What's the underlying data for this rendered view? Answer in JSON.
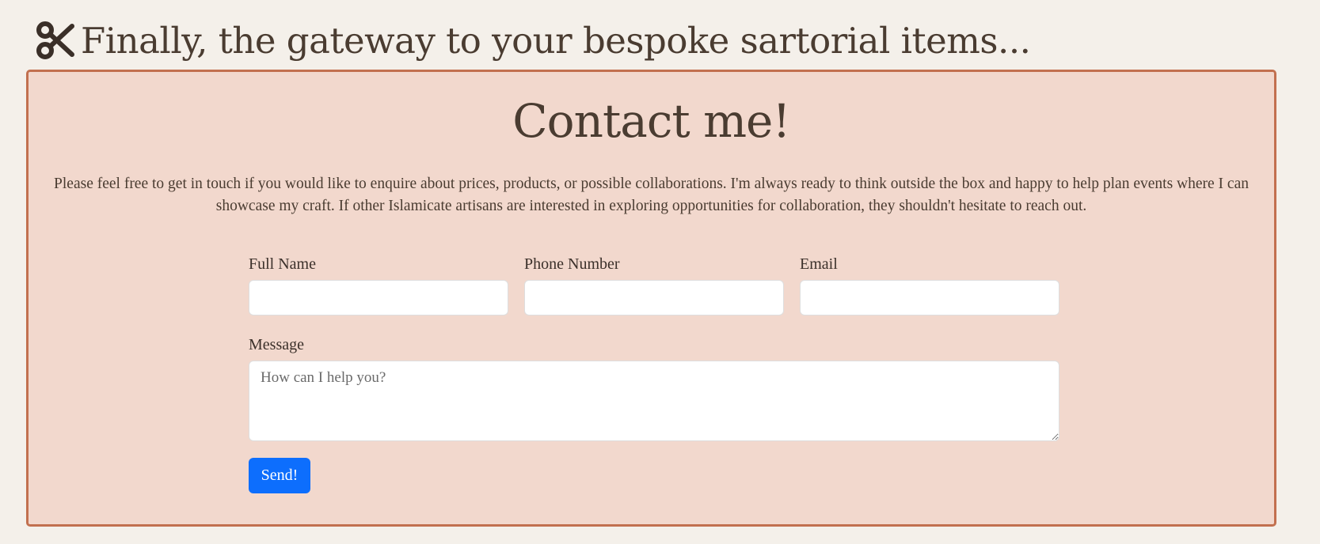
{
  "header": {
    "icon": "scissors-icon",
    "title": "Finally, the gateway to your bespoke sartorial items..."
  },
  "contact": {
    "heading": "Contact me!",
    "intro": "Please feel free to get in touch if you would like to enquire about prices, products, or possible collaborations. I'm always ready to think outside the box and happy to help plan events where I can showcase my craft. If other Islamicate artisans are interested in exploring opportunities for collaboration, they shouldn't hesitate to reach out.",
    "form": {
      "full_name": {
        "label": "Full Name",
        "value": ""
      },
      "phone": {
        "label": "Phone Number",
        "value": ""
      },
      "email": {
        "label": "Email",
        "value": ""
      },
      "message": {
        "label": "Message",
        "placeholder": "How can I help you?",
        "value": ""
      },
      "submit_label": "Send!"
    }
  },
  "colors": {
    "page_background": "#f4f0ea",
    "card_background": "#f2d8cd",
    "card_border": "#c2704f",
    "text": "#4a3c31",
    "button": "#0d6efd"
  }
}
